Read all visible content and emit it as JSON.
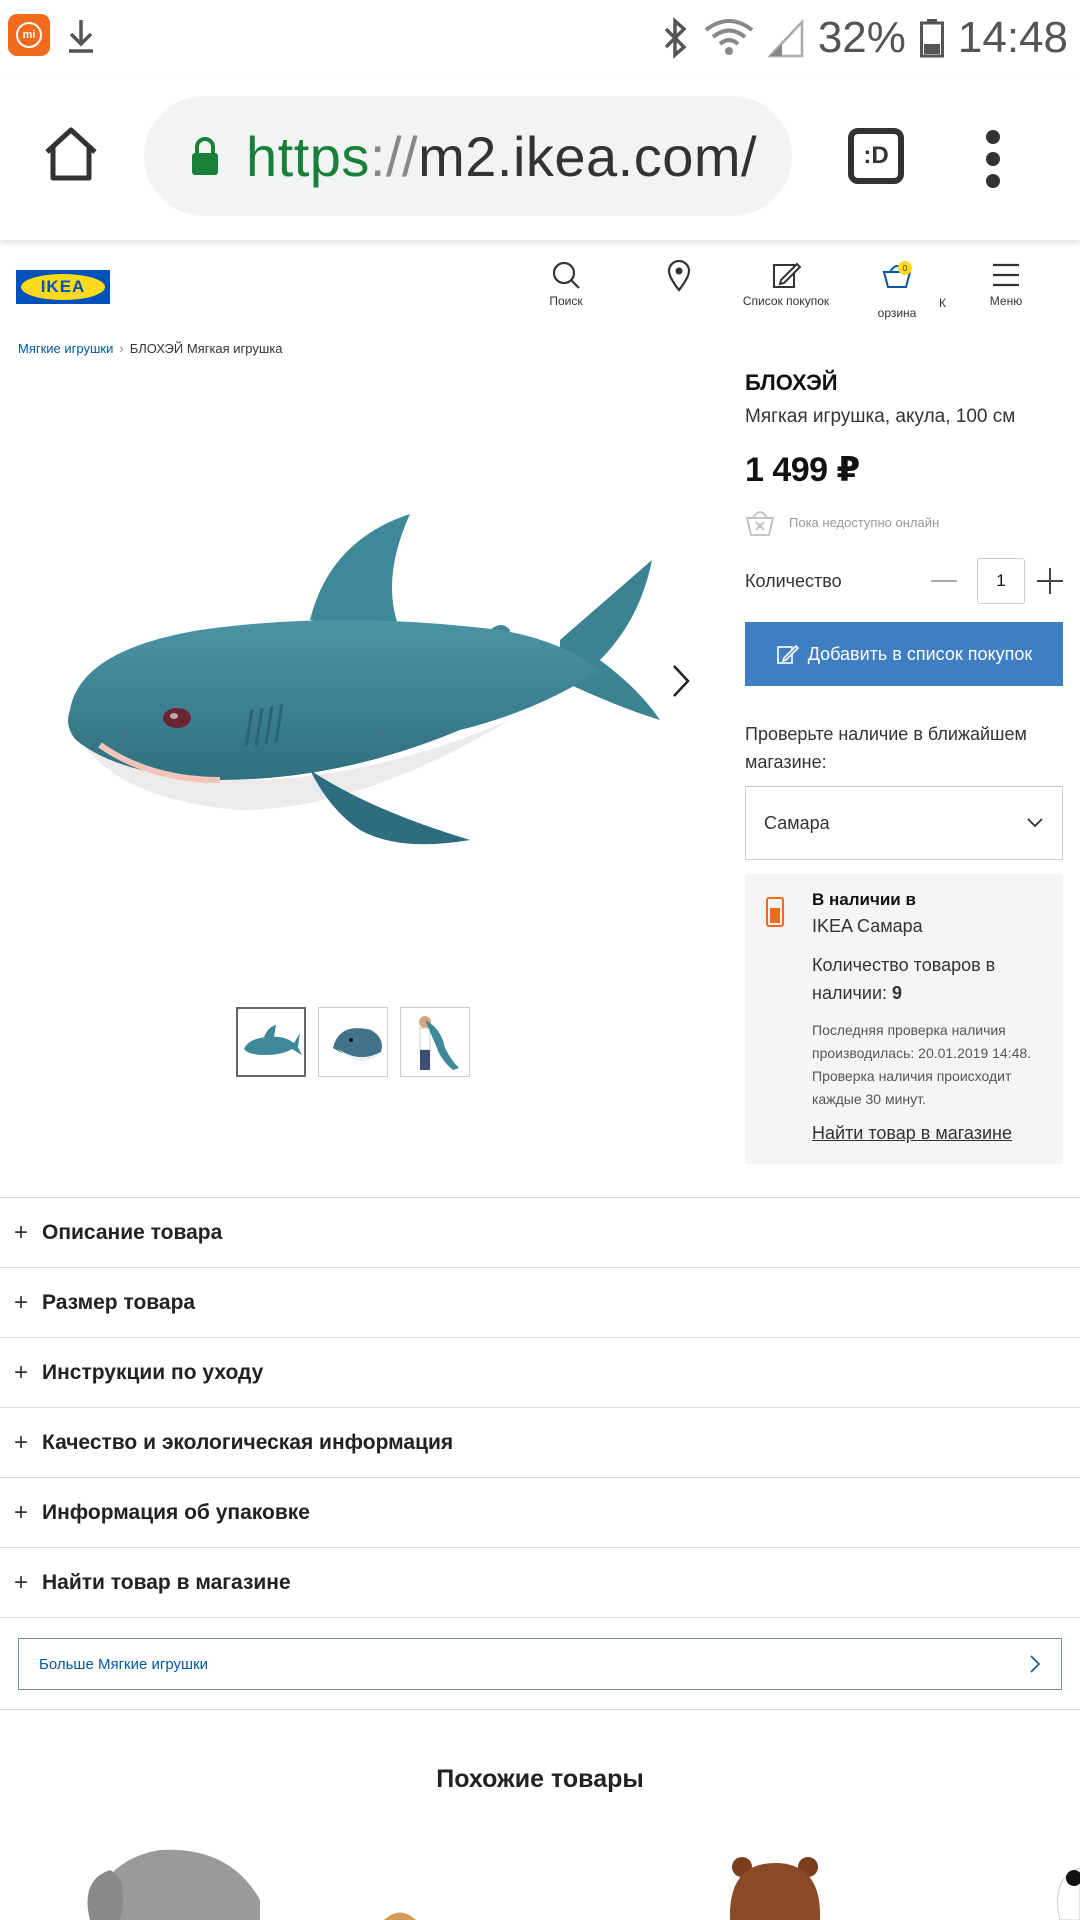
{
  "status_bar": {
    "battery": "32%",
    "time": "14:48"
  },
  "browser": {
    "url_scheme": "https",
    "url_sep": "://",
    "url_host": "m2.ikea.com/",
    "tabs_label": ":D"
  },
  "header": {
    "logo": "IKEA",
    "nav": {
      "search": "Поиск",
      "shopping_list": "Список покупок",
      "cart_badge": "0",
      "cart": "орзина",
      "cart_k": "К",
      "menu": "Меню"
    }
  },
  "breadcrumb": {
    "parent": "Мягкие игрушки",
    "current": "БЛОХЭЙ Мягкая игрушка"
  },
  "product": {
    "name": "БЛОХЭЙ",
    "description": "Мягкая игрушка, акула, 100 см",
    "price": "1 499 ₽",
    "online_availability": "Пока недоступно онлайн",
    "quantity_label": "Количество",
    "quantity": "1",
    "add_button": "Добавить в список покупок"
  },
  "store": {
    "check_label": "Проверьте наличие в ближайшем магазине:",
    "selected_store": "Самара",
    "in_stock_title": "В наличии в",
    "store_name": "IKEA Самара",
    "count_label": "Количество товаров в наличии:",
    "count": "9",
    "last_check": "Последняя проверка наличия производилась: 20.01.2019 14:48. Проверка наличия происходит каждые 30 минут.",
    "find_link": "Найти товар в магазине"
  },
  "accordion": [
    "Описание товара",
    "Размер товара",
    "Инструкции по уходу",
    "Качество и экологическая информация",
    "Информация об упаковке",
    "Найти товар в магазине"
  ],
  "more_link": "Больше Мягкие игрушки",
  "similar_title": "Похожие товары",
  "colors": {
    "accent": "#3e7ec3",
    "link": "#0058a3",
    "ikea_blue": "#0051ba",
    "ikea_yellow": "#ffda1a",
    "stock_orange": "#f26b1d"
  }
}
